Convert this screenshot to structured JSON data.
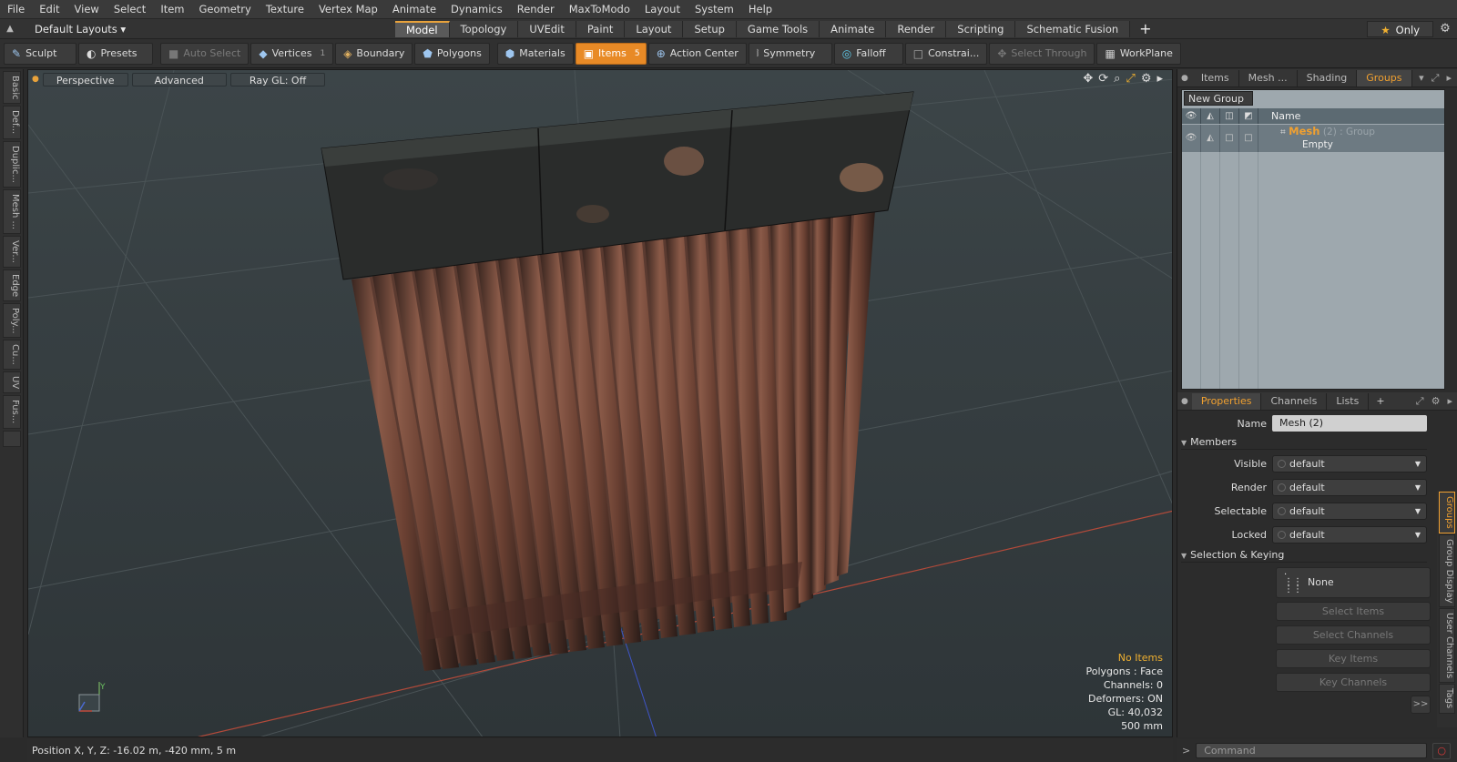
{
  "menu": [
    "File",
    "Edit",
    "View",
    "Select",
    "Item",
    "Geometry",
    "Texture",
    "Vertex Map",
    "Animate",
    "Dynamics",
    "Render",
    "MaxToModo",
    "Layout",
    "System",
    "Help"
  ],
  "layouts_label": "Default Layouts ▾",
  "mode_tabs": [
    "Model",
    "Topology",
    "UVEdit",
    "Paint",
    "Layout",
    "Setup",
    "Game Tools",
    "Animate",
    "Render",
    "Scripting",
    "Schematic Fusion"
  ],
  "only_label": "Only",
  "toolbar": {
    "sculpt": "Sculpt",
    "presets": "Presets",
    "auto_select": "Auto Select",
    "vertices": "Vertices",
    "vertices_count": "1",
    "boundary": "Boundary",
    "polygons": "Polygons",
    "materials": "Materials",
    "items": "Items",
    "items_count": "5",
    "action_center": "Action Center",
    "symmetry": "Symmetry",
    "falloff": "Falloff",
    "constraints": "Constrai...",
    "select_through": "Select Through",
    "workplane": "WorkPlane"
  },
  "left_tabs": [
    "Basic",
    "Def...",
    "Duplic...",
    "Mesh ...",
    "Ver...",
    "Edge",
    "Poly...",
    "Cu...",
    "UV",
    "Fus..."
  ],
  "viewport": {
    "view_label": "Perspective",
    "shading_label": "Advanced",
    "raygl_label": "Ray GL: Off",
    "info": {
      "no_items": "No Items",
      "polygons": "Polygons : Face",
      "channels": "Channels: 0",
      "deformers": "Deformers: ON",
      "gl": "GL: 40,032",
      "scale": "500 mm"
    }
  },
  "top_panel_tabs": [
    "Items",
    "Mesh ...",
    "Shading",
    "Groups"
  ],
  "groups": {
    "new_group": "New Group",
    "name_header": "Name",
    "item_name": "Mesh",
    "item_suffix": "(2) : Group",
    "item_sub": "Empty"
  },
  "bottom_panel_tabs": [
    "Properties",
    "Channels",
    "Lists"
  ],
  "properties": {
    "name_label": "Name",
    "name_value": "Mesh (2)",
    "members_section": "Members",
    "visible_label": "Visible",
    "visible_value": "default",
    "render_label": "Render",
    "render_value": "default",
    "selectable_label": "Selectable",
    "selectable_value": "default",
    "locked_label": "Locked",
    "locked_value": "default",
    "selection_section": "Selection & Keying",
    "none_label": "None",
    "select_items": "Select Items",
    "select_channels": "Select Channels",
    "key_items": "Key Items",
    "key_channels": "Key Channels",
    "expand": ">>"
  },
  "right_vtabs": [
    "Groups",
    "Group Display",
    "User Channels",
    "Tags"
  ],
  "command_placeholder": "Command",
  "status": "Position X, Y, Z:  -16.02 m, -420 mm, 5 m",
  "colors": {
    "accent": "#e88a26",
    "highlight_text": "#f0a030"
  }
}
